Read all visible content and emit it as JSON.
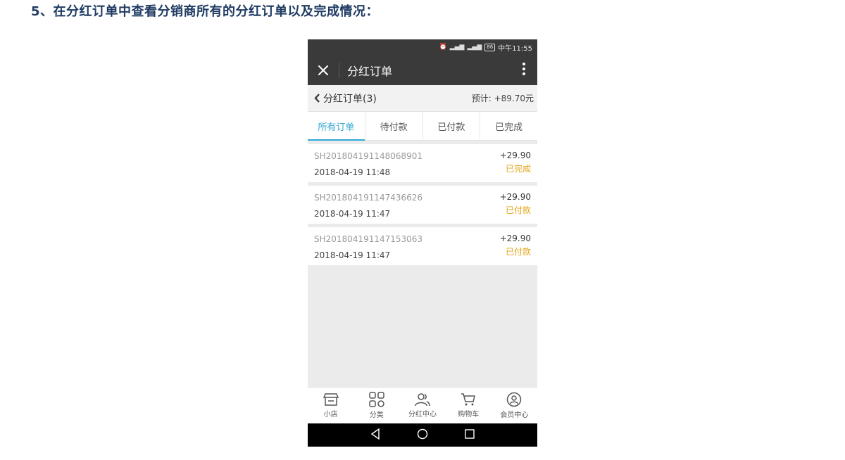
{
  "doc": {
    "heading": "5、在分红订单中查看分销商所有的分红订单以及完成情况："
  },
  "status_bar": {
    "battery": "86",
    "time": "中午11:55"
  },
  "title_bar": {
    "title": "分红订单"
  },
  "subheader": {
    "back_label": "分红订单(3)",
    "estimate": "预计: +89.70元"
  },
  "tabs": [
    {
      "label": "所有订单",
      "active": true
    },
    {
      "label": "待付款"
    },
    {
      "label": "已付款"
    },
    {
      "label": "已完成"
    }
  ],
  "orders": [
    {
      "order_no": "SH201804191148068901",
      "time": "2018-04-19 11:48",
      "amount": "+29.90",
      "status": "已完成"
    },
    {
      "order_no": "SH201804191147436626",
      "time": "2018-04-19 11:47",
      "amount": "+29.90",
      "status": "已付款"
    },
    {
      "order_no": "SH201804191147153063",
      "time": "2018-04-19 11:47",
      "amount": "+29.90",
      "status": "已付款"
    }
  ],
  "bottom_tabs": [
    {
      "label": "小店",
      "icon": "shop-icon"
    },
    {
      "label": "分类",
      "icon": "category-grid-icon"
    },
    {
      "label": "分红中心",
      "icon": "users-icon"
    },
    {
      "label": "购物车",
      "icon": "cart-icon"
    },
    {
      "label": "会员中心",
      "icon": "member-icon"
    }
  ],
  "colors": {
    "accent": "#2ea8d6",
    "status": "#e4a417",
    "header_bg": "#3a3a3a"
  }
}
